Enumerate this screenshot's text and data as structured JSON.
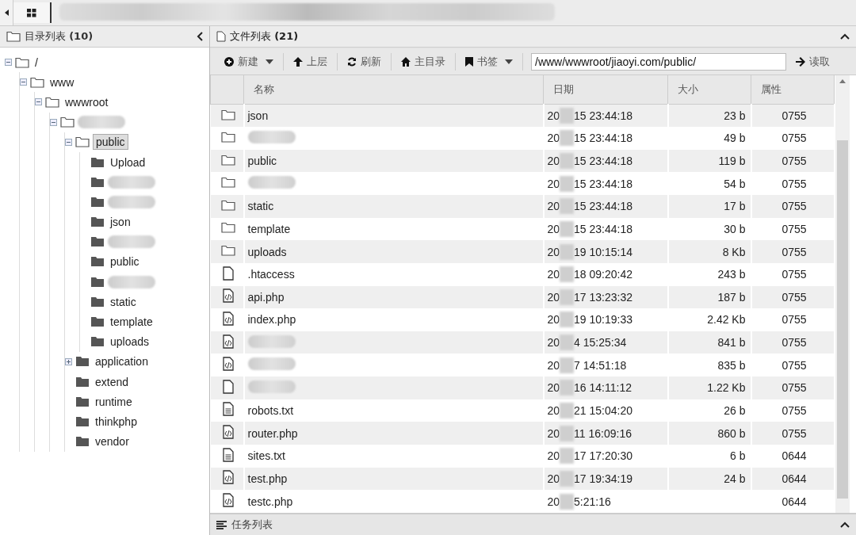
{
  "left_panel": {
    "title": "目录列表",
    "count": "(10)"
  },
  "tree": [
    {
      "label": "/",
      "expanded": true,
      "selected": false,
      "children": [
        {
          "label": "www",
          "expanded": true,
          "selected": false,
          "children": [
            {
              "label": "wwwroot",
              "expanded": true,
              "selected": false,
              "children": [
                {
                  "expanded": true,
                  "selected": false,
                  "children": [
                    {
                      "label": "public",
                      "expanded": true,
                      "selected": true,
                      "children": [
                        {
                          "label": "Upload",
                          "expanded": false,
                          "selected": false
                        },
                        {
                          "expanded": false,
                          "selected": false
                        },
                        {
                          "expanded": false,
                          "selected": false
                        },
                        {
                          "label": "json",
                          "expanded": false,
                          "selected": false
                        },
                        {
                          "expanded": false,
                          "selected": false
                        },
                        {
                          "label": "public",
                          "expanded": false,
                          "selected": false
                        },
                        {
                          "expanded": false,
                          "selected": false
                        },
                        {
                          "label": "static",
                          "expanded": false,
                          "selected": false
                        },
                        {
                          "label": "template",
                          "expanded": false,
                          "selected": false
                        },
                        {
                          "label": "uploads",
                          "expanded": false,
                          "selected": false
                        }
                      ]
                    },
                    {
                      "label": "application",
                      "expanded": false,
                      "selected": false,
                      "collapsible": true
                    },
                    {
                      "label": "extend",
                      "expanded": false,
                      "selected": false
                    },
                    {
                      "label": "runtime",
                      "expanded": false,
                      "selected": false
                    },
                    {
                      "label": "thinkphp",
                      "expanded": false,
                      "selected": false
                    },
                    {
                      "label": "vendor",
                      "expanded": false,
                      "selected": false
                    }
                  ]
                }
              ]
            }
          ]
        }
      ]
    }
  ],
  "right_panel": {
    "title": "文件列表",
    "count": "(21)"
  },
  "toolbar": [
    {
      "kind": "new",
      "label": "新建",
      "dropdown": true
    },
    {
      "kind": "up",
      "label": "上层",
      "dropdown": false
    },
    {
      "kind": "refresh",
      "label": "刷新",
      "dropdown": false
    },
    {
      "kind": "home",
      "label": "主目录",
      "dropdown": false
    },
    {
      "kind": "bookmark",
      "label": "书签",
      "dropdown": true
    }
  ],
  "path": {
    "value": "/www/wwwroot/jiaoyi.com/public/"
  },
  "read_button": {
    "label": "读取"
  },
  "table": {
    "columns": [
      "名称",
      "日期",
      "大小",
      "属性"
    ],
    "rows": [
      {
        "kind": "folder",
        "name": "json",
        "date_start": "20",
        "date_end": "15 23:44:18",
        "size": "23 b",
        "attr": "0755"
      },
      {
        "kind": "folder",
        "date_start": "20",
        "date_end": "15 23:44:18",
        "size": "49 b",
        "attr": "0755"
      },
      {
        "kind": "folder",
        "name": "public",
        "date_start": "20",
        "date_end": "15 23:44:18",
        "size": "119 b",
        "attr": "0755"
      },
      {
        "kind": "folder",
        "date_start": "20",
        "date_end": "15 23:44:18",
        "size": "54 b",
        "attr": "0755"
      },
      {
        "kind": "folder",
        "name": "static",
        "date_start": "20",
        "date_end": "15 23:44:18",
        "size": "17 b",
        "attr": "0755"
      },
      {
        "kind": "folder",
        "name": "template",
        "date_start": "20",
        "date_end": "15 23:44:18",
        "size": "30 b",
        "attr": "0755"
      },
      {
        "kind": "folder",
        "name": "uploads",
        "date_start": "20",
        "date_end": "19 10:15:14",
        "size": "8 Kb",
        "attr": "0755"
      },
      {
        "kind": "file",
        "name": ".htaccess",
        "date_start": "20",
        "date_end": "18 09:20:42",
        "size": "243 b",
        "attr": "0755"
      },
      {
        "kind": "code",
        "name": "api.php",
        "date_start": "20",
        "date_end": "17 13:23:32",
        "size": "187 b",
        "attr": "0755"
      },
      {
        "kind": "code",
        "name": "index.php",
        "date_start": "20",
        "date_end": "19 10:19:33",
        "size": "2.42 Kb",
        "attr": "0755"
      },
      {
        "kind": "code",
        "date_start": "20",
        "date_end": "4 15:25:34",
        "size": "841 b",
        "attr": "0755"
      },
      {
        "kind": "code",
        "date_start": "20",
        "date_end": "7 14:51:18",
        "size": "835 b",
        "attr": "0755"
      },
      {
        "kind": "file",
        "date_start": "20",
        "date_end": "16 14:11:12",
        "size": "1.22 Kb",
        "attr": "0755"
      },
      {
        "kind": "text",
        "name": "robots.txt",
        "date_start": "20",
        "date_end": "21 15:04:20",
        "size": "26 b",
        "attr": "0755"
      },
      {
        "kind": "code",
        "name": "router.php",
        "date_start": "20",
        "date_end": "11 16:09:16",
        "size": "860 b",
        "attr": "0755"
      },
      {
        "kind": "text",
        "name": "sites.txt",
        "date_start": "20",
        "date_end": "17 17:20:30",
        "size": "6 b",
        "attr": "0644"
      },
      {
        "kind": "code",
        "name": "test.php",
        "date_start": "20",
        "date_end": "17 19:34:19",
        "size": "24 b",
        "attr": "0644"
      },
      {
        "kind": "code",
        "name": "testc.php",
        "date_start": "20",
        "date_end": "5:21:16",
        "attr": "0644"
      }
    ]
  },
  "task_panel": {
    "title": "任务列表"
  }
}
